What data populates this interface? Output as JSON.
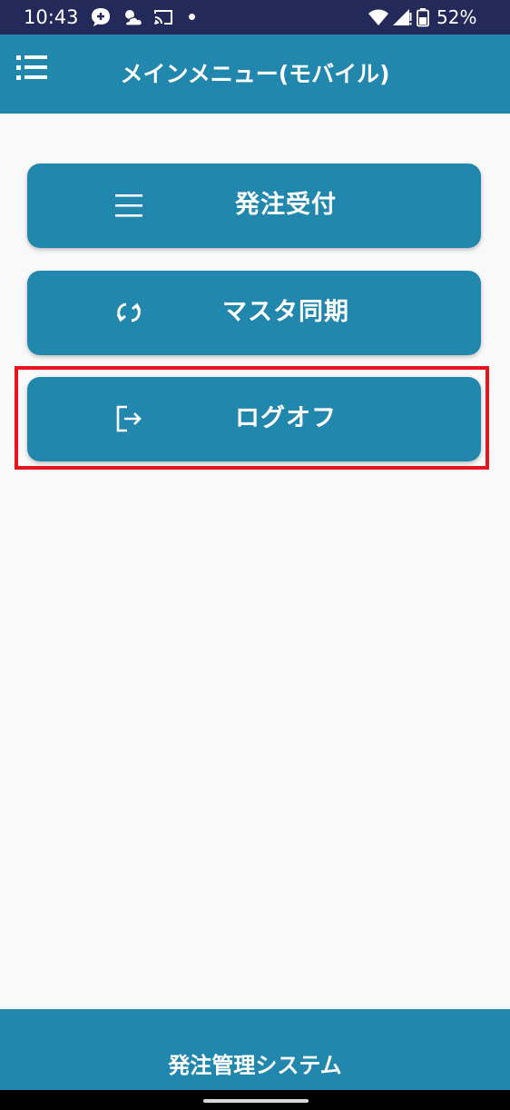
{
  "status_bar": {
    "time": "10:43",
    "battery": "52%",
    "icons": [
      "chat-plus-icon",
      "weather-icon",
      "cast-icon",
      "notification-dot-icon",
      "wifi-icon",
      "signal-icon",
      "battery-icon"
    ]
  },
  "header": {
    "title": "メインメニュー(モバイル)",
    "menu_icon": "list-menu-icon"
  },
  "menu": {
    "items": [
      {
        "label": "発注受付",
        "icon": "lines-icon"
      },
      {
        "label": "マスタ同期",
        "icon": "sync-icon"
      },
      {
        "label": "ログオフ",
        "icon": "logout-icon",
        "highlighted": true
      }
    ]
  },
  "footer": {
    "text": "発注管理システム"
  },
  "colors": {
    "primary": "#2287ad",
    "status_bar": "#232a5a",
    "background": "#f9f9f9",
    "highlight": "#e8141c"
  }
}
